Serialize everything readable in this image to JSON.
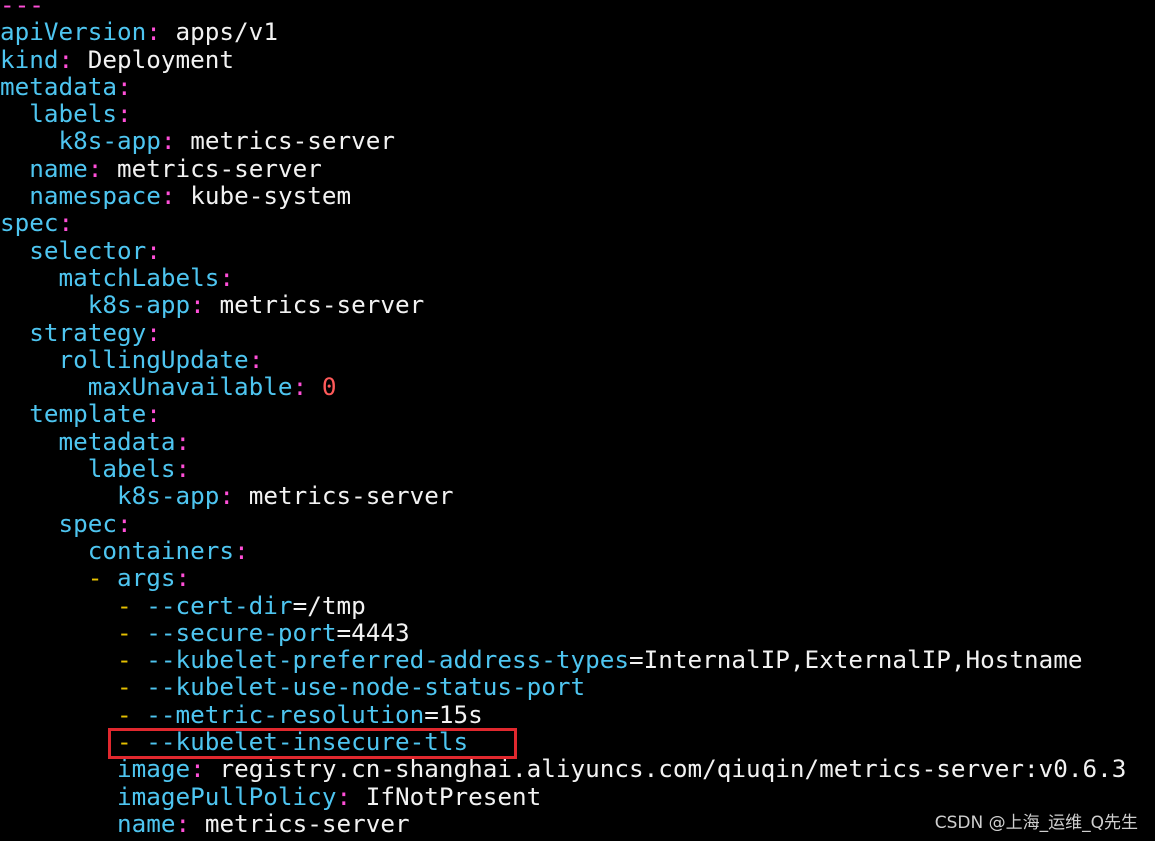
{
  "lines": [
    {
      "parts": [
        {
          "t": "---",
          "c": "p"
        }
      ]
    },
    {
      "parts": [
        {
          "t": "apiVersion",
          "c": "k"
        },
        {
          "t": ": ",
          "c": "p"
        },
        {
          "t": "apps/v1",
          "c": "v"
        }
      ]
    },
    {
      "parts": [
        {
          "t": "kind",
          "c": "k"
        },
        {
          "t": ": ",
          "c": "p"
        },
        {
          "t": "Deployment",
          "c": "v"
        }
      ]
    },
    {
      "parts": [
        {
          "t": "metadata",
          "c": "k"
        },
        {
          "t": ":",
          "c": "p"
        }
      ]
    },
    {
      "parts": [
        {
          "t": "  labels",
          "c": "k"
        },
        {
          "t": ":",
          "c": "p"
        }
      ]
    },
    {
      "parts": [
        {
          "t": "    k8s-app",
          "c": "k"
        },
        {
          "t": ": ",
          "c": "p"
        },
        {
          "t": "metrics-server",
          "c": "v"
        }
      ]
    },
    {
      "parts": [
        {
          "t": "  name",
          "c": "k"
        },
        {
          "t": ": ",
          "c": "p"
        },
        {
          "t": "metrics-server",
          "c": "v"
        }
      ]
    },
    {
      "parts": [
        {
          "t": "  namespace",
          "c": "k"
        },
        {
          "t": ": ",
          "c": "p"
        },
        {
          "t": "kube-system",
          "c": "v"
        }
      ]
    },
    {
      "parts": [
        {
          "t": "spec",
          "c": "k"
        },
        {
          "t": ":",
          "c": "p"
        }
      ]
    },
    {
      "parts": [
        {
          "t": "  selector",
          "c": "k"
        },
        {
          "t": ":",
          "c": "p"
        }
      ]
    },
    {
      "parts": [
        {
          "t": "    matchLabels",
          "c": "k"
        },
        {
          "t": ":",
          "c": "p"
        }
      ]
    },
    {
      "parts": [
        {
          "t": "      k8s-app",
          "c": "k"
        },
        {
          "t": ": ",
          "c": "p"
        },
        {
          "t": "metrics-server",
          "c": "v"
        }
      ]
    },
    {
      "parts": [
        {
          "t": "  strategy",
          "c": "k"
        },
        {
          "t": ":",
          "c": "p"
        }
      ]
    },
    {
      "parts": [
        {
          "t": "    rollingUpdate",
          "c": "k"
        },
        {
          "t": ":",
          "c": "p"
        }
      ]
    },
    {
      "parts": [
        {
          "t": "      maxUnavailable",
          "c": "k"
        },
        {
          "t": ": ",
          "c": "p"
        },
        {
          "t": "0",
          "c": "n"
        }
      ]
    },
    {
      "parts": [
        {
          "t": "  template",
          "c": "k"
        },
        {
          "t": ":",
          "c": "p"
        }
      ]
    },
    {
      "parts": [
        {
          "t": "    metadata",
          "c": "k"
        },
        {
          "t": ":",
          "c": "p"
        }
      ]
    },
    {
      "parts": [
        {
          "t": "      labels",
          "c": "k"
        },
        {
          "t": ":",
          "c": "p"
        }
      ]
    },
    {
      "parts": [
        {
          "t": "        k8s-app",
          "c": "k"
        },
        {
          "t": ": ",
          "c": "p"
        },
        {
          "t": "metrics-server",
          "c": "v"
        }
      ]
    },
    {
      "parts": [
        {
          "t": "    spec",
          "c": "k"
        },
        {
          "t": ":",
          "c": "p"
        }
      ]
    },
    {
      "parts": [
        {
          "t": "      containers",
          "c": "k"
        },
        {
          "t": ":",
          "c": "p"
        }
      ]
    },
    {
      "parts": [
        {
          "t": "      - ",
          "c": "d"
        },
        {
          "t": "args",
          "c": "k"
        },
        {
          "t": ":",
          "c": "p"
        }
      ]
    },
    {
      "parts": [
        {
          "t": "        - ",
          "c": "d"
        },
        {
          "t": "--cert-dir",
          "c": "k"
        },
        {
          "t": "=/tmp",
          "c": "v"
        }
      ]
    },
    {
      "parts": [
        {
          "t": "        - ",
          "c": "d"
        },
        {
          "t": "--secure-port",
          "c": "k"
        },
        {
          "t": "=4443",
          "c": "v"
        }
      ]
    },
    {
      "parts": [
        {
          "t": "        - ",
          "c": "d"
        },
        {
          "t": "--kubelet-preferred-address-types",
          "c": "k"
        },
        {
          "t": "=InternalIP,ExternalIP,Hostname",
          "c": "v"
        }
      ]
    },
    {
      "parts": [
        {
          "t": "        - ",
          "c": "d"
        },
        {
          "t": "--kubelet-use-node-status-port",
          "c": "k"
        }
      ]
    },
    {
      "parts": [
        {
          "t": "        - ",
          "c": "d"
        },
        {
          "t": "--metric-resolution",
          "c": "k"
        },
        {
          "t": "=15s",
          "c": "v"
        }
      ]
    },
    {
      "parts": [
        {
          "t": "        - ",
          "c": "d"
        },
        {
          "t": "--kubelet-insecure-tls",
          "c": "k"
        }
      ]
    },
    {
      "parts": [
        {
          "t": "        image",
          "c": "k"
        },
        {
          "t": ": ",
          "c": "p"
        },
        {
          "t": "registry.cn-shanghai.aliyuncs.com/qiuqin/metrics-server:v0.6.3",
          "c": "v"
        }
      ]
    },
    {
      "parts": [
        {
          "t": "        imagePullPolicy",
          "c": "k"
        },
        {
          "t": ": ",
          "c": "p"
        },
        {
          "t": "IfNotPresent",
          "c": "v"
        }
      ]
    },
    {
      "parts": [
        {
          "t": "        name",
          "c": "k"
        },
        {
          "t": ": ",
          "c": "p"
        },
        {
          "t": "metrics-server",
          "c": "v"
        }
      ]
    }
  ],
  "highlight": {
    "line_index": 27,
    "color": "#e0282e"
  },
  "watermark": "CSDN @上海_运维_Q先生",
  "colors": {
    "key": "#4ec5f0",
    "punct": "#ff4fd8",
    "value": "#f2f2f2",
    "number": "#ff5a5a",
    "dash": "#e5c000",
    "background": "#000000"
  }
}
